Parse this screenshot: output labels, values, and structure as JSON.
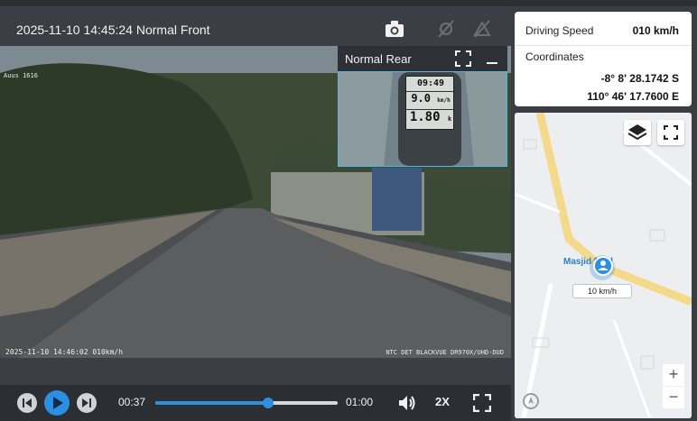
{
  "player": {
    "header_title": "2025-11-10 14:45:24 Normal Front",
    "front_osd_top": "Auus 1616",
    "front_osd_bottom_left": "2025-11-10 14:46:02 010km/h",
    "front_osd_bottom_right": "NTC DET BLACKVUE DR970X/UHD-DUD",
    "rear_title": "Normal Rear",
    "rear_device": {
      "time": "09:49",
      "speed": "9.0",
      "speed_unit": "km/h",
      "distance": "1.80",
      "distance_unit": "k"
    }
  },
  "controls": {
    "current_time": "00:37",
    "total_time": "01:00",
    "progress_fraction": 0.62,
    "playback_speed": "2X"
  },
  "info": {
    "speed_label": "Driving Speed",
    "speed_value": "010 km/h",
    "coordinates_label": "Coordinates",
    "latitude": "-8° 8' 28.1742 S",
    "longitude": "110° 46' 17.7600 E"
  },
  "map": {
    "place_name": "Masjid Bilal",
    "marker_speed": "10 km/h",
    "zoom_in": "+",
    "zoom_out": "−"
  },
  "colors": {
    "accent": "#2c8fe2",
    "road": "#f4d98a",
    "panel": "#3b3f45"
  },
  "icons": [
    "camera-icon",
    "gps-off-icon",
    "tune-icon",
    "expand-icon",
    "minimize-icon",
    "prev-frame-icon",
    "play-icon",
    "next-frame-icon",
    "volume-icon",
    "fullscreen-icon",
    "layers-icon",
    "compass-icon"
  ]
}
